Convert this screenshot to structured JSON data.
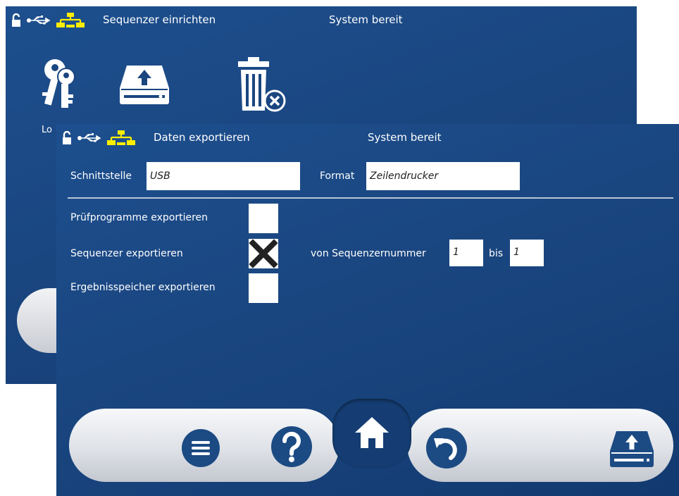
{
  "back_screen": {
    "status_title": "Sequenzer einrichten",
    "status_text": "System bereit",
    "label_partial": "Lo",
    "icons": [
      "lock-open-icon",
      "usb-icon",
      "network-icon",
      "keys-icon",
      "export-drive-icon",
      "trash-delete-icon"
    ]
  },
  "front_screen": {
    "status_title": "Daten exportieren",
    "status_text": "System bereit",
    "interface_label": "Schnittstelle",
    "interface_value": "USB",
    "format_label": "Format",
    "format_value": "Zeilendrucker",
    "export_programs_label": "Prüfprogramme exportieren",
    "export_programs_checked": false,
    "export_sequencer_label": "Sequenzer exportieren",
    "export_sequencer_checked": true,
    "export_results_label": "Ergebnisspeicher exportieren",
    "export_results_checked": false,
    "from_seq_label": "von Sequenzernummer",
    "from_seq_value": "1",
    "to_label": "bis",
    "to_value": "1"
  },
  "toolbar": {
    "buttons": [
      "menu-icon",
      "help-icon",
      "home-icon",
      "back-icon",
      "export-drive-icon"
    ]
  },
  "colors": {
    "background": "#1a4680",
    "network_icon": "#ffee00",
    "button_blue": "#1c4a83",
    "toolbar_pill": "#dfe2e7"
  }
}
